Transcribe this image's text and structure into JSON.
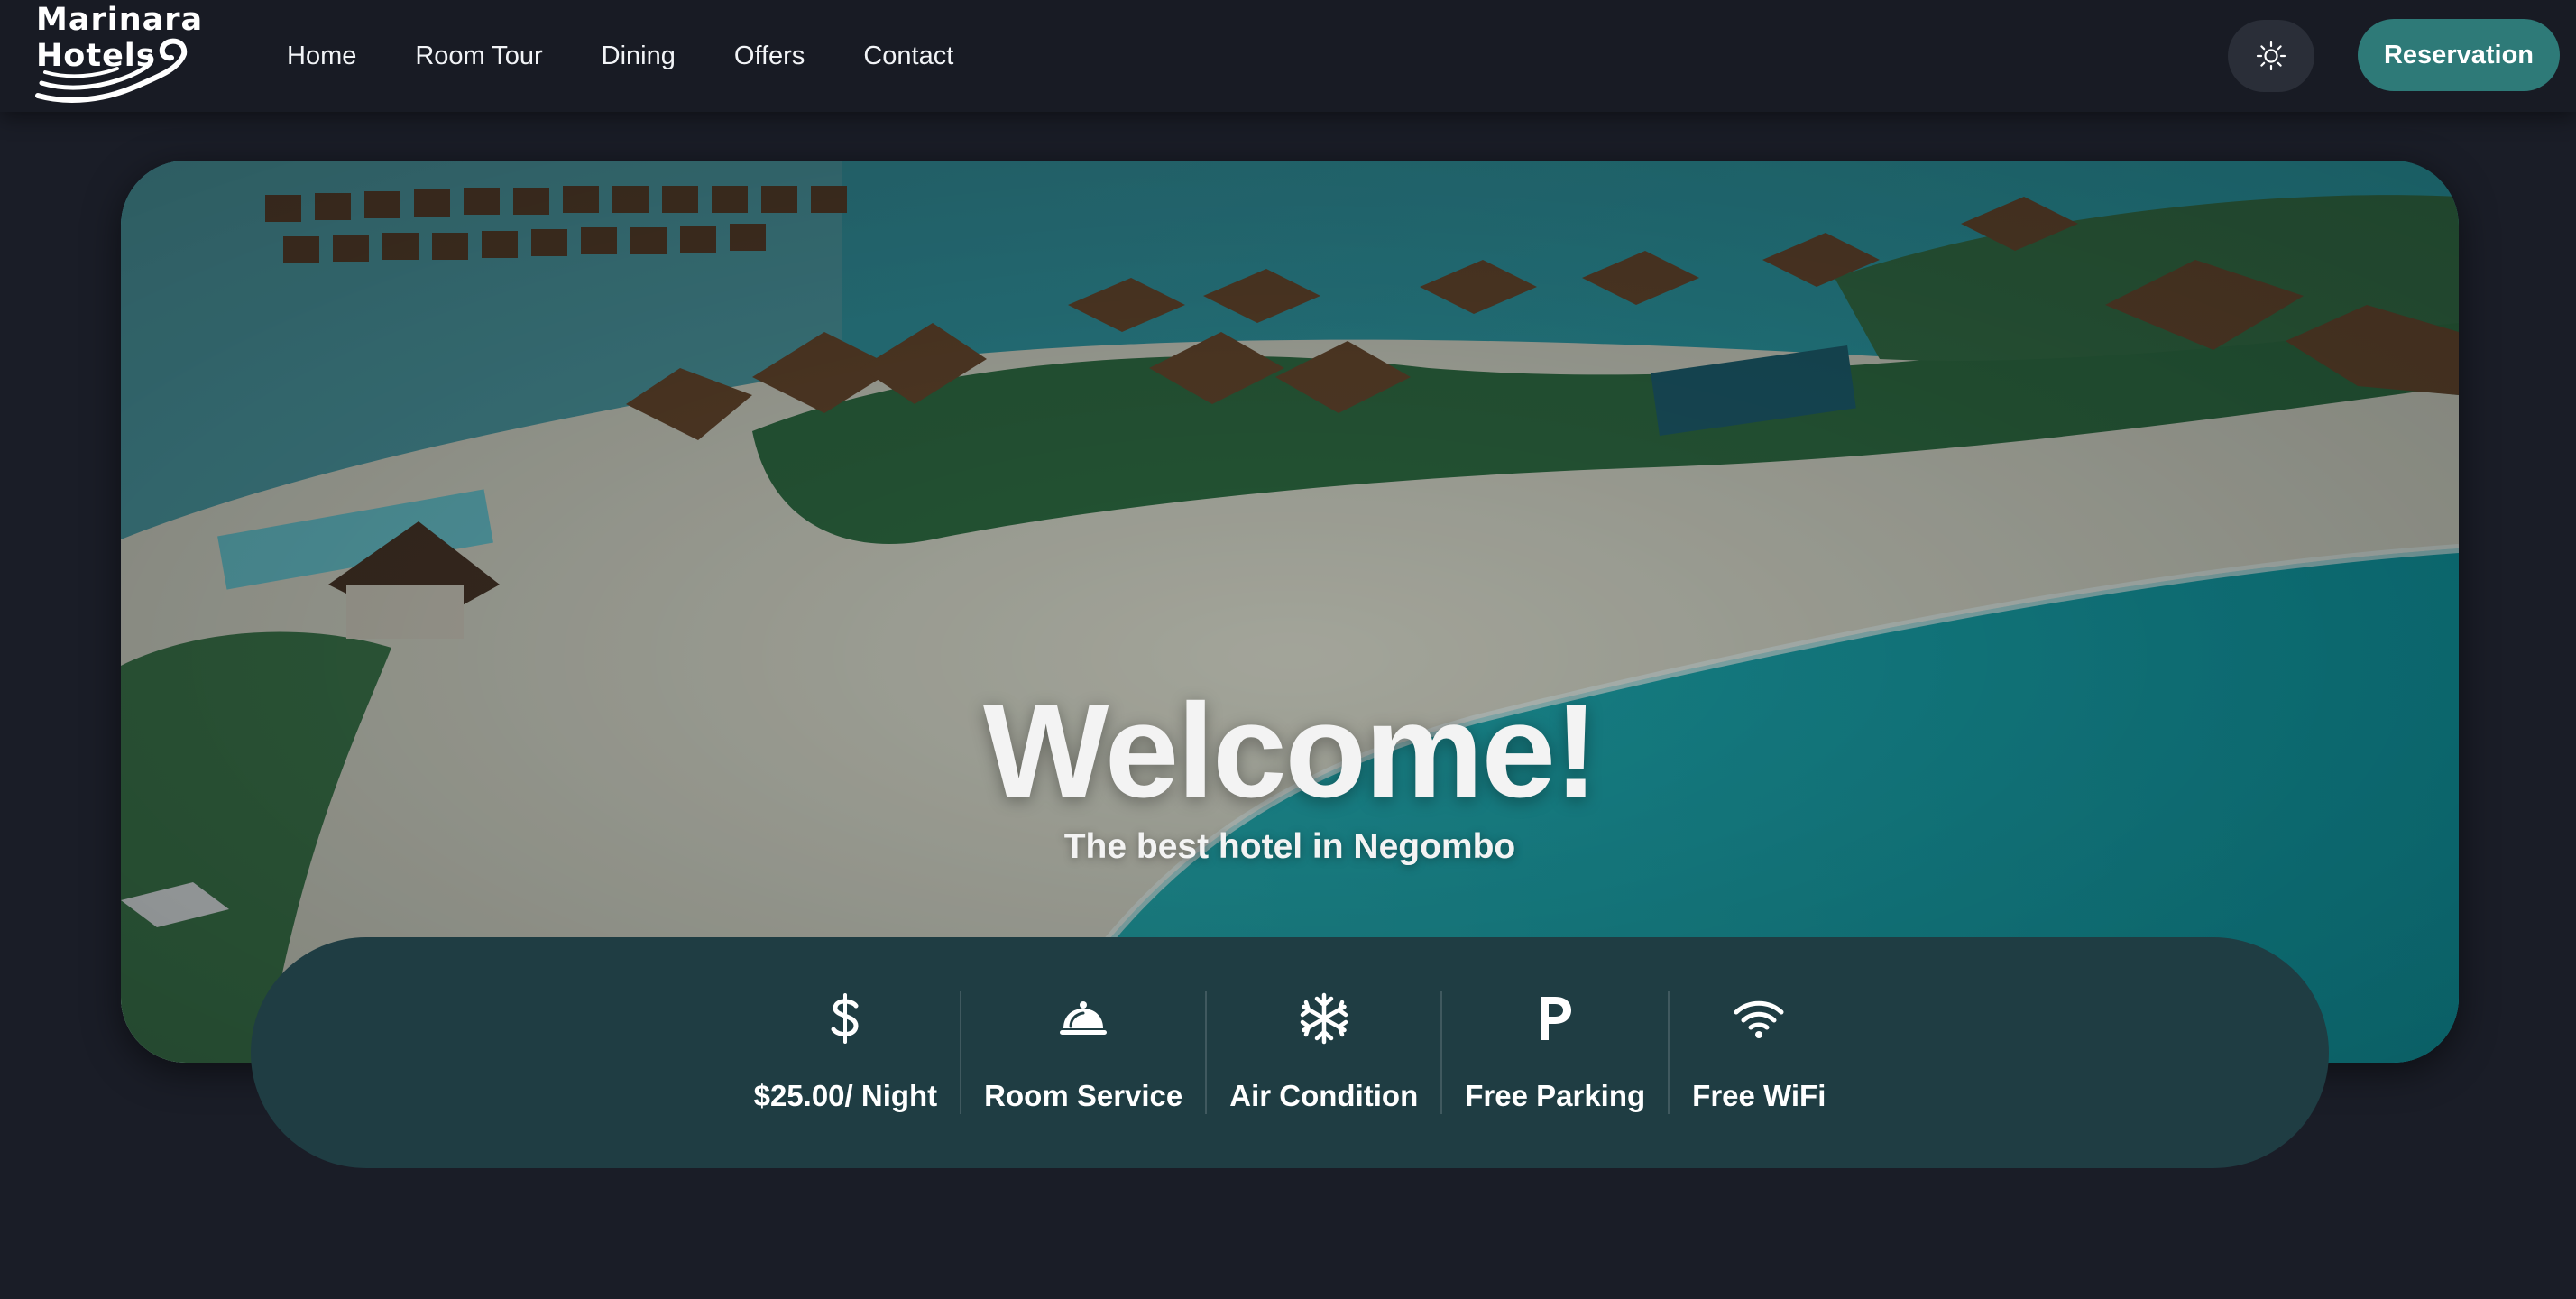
{
  "brand": {
    "logo_text": "Marinara\nHotels",
    "logo_icon": "waves-icon"
  },
  "nav": {
    "items": [
      {
        "label": "Home"
      },
      {
        "label": "Room Tour"
      },
      {
        "label": "Dining"
      },
      {
        "label": "Offers"
      },
      {
        "label": "Contact"
      }
    ]
  },
  "header": {
    "theme_toggle_icon": "sun-icon",
    "reservation_label": "Reservation"
  },
  "hero": {
    "title": "Welcome!",
    "subtitle": "The best hotel in Negombo",
    "image": "aerial-resort-photo"
  },
  "amenities": [
    {
      "icon": "dollar-icon",
      "label": "$25.00/ Night"
    },
    {
      "icon": "room-service-icon",
      "label": "Room Service"
    },
    {
      "icon": "snowflake-icon",
      "label": "Air Condition"
    },
    {
      "icon": "parking-icon",
      "label": "Free Parking"
    },
    {
      "icon": "wifi-icon",
      "label": "Free WiFi"
    }
  ],
  "colors": {
    "background": "#1a1d27",
    "header": "#181b24",
    "accent": "#2e7a78",
    "amenity_bar": "#1f3d43",
    "theme_button": "#2a2e38"
  }
}
